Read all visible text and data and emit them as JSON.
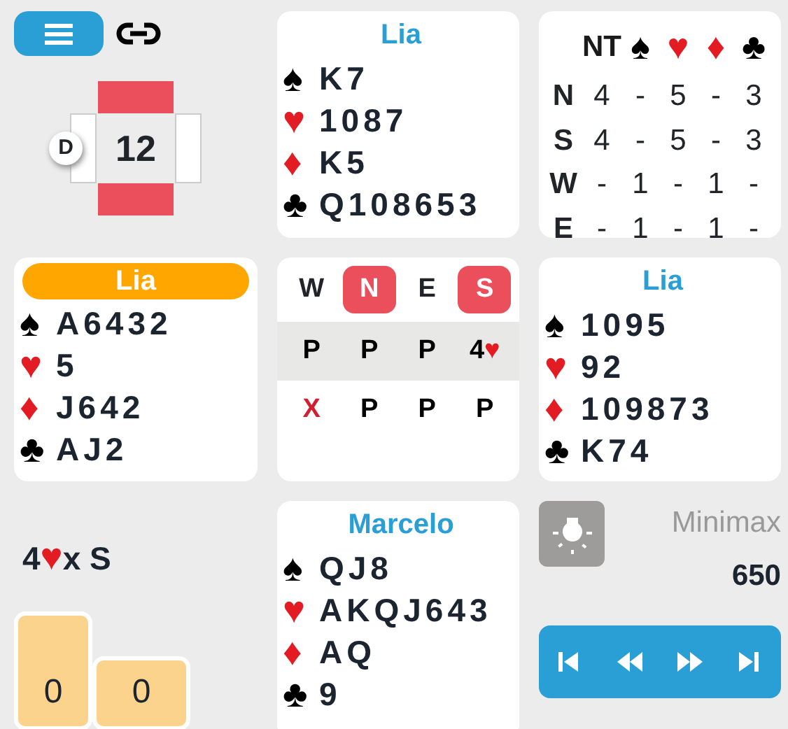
{
  "board": {
    "number": "12",
    "dealer_mark": "D",
    "west_is_dealer": true,
    "ns_vulnerable": true,
    "ew_vulnerable": false
  },
  "north": {
    "player": "Lia",
    "active": false,
    "suits": [
      {
        "symbol": "♠",
        "color": "#000000",
        "cards": "K7"
      },
      {
        "symbol": "♥",
        "color": "#e31b23",
        "cards": "1087"
      },
      {
        "symbol": "♦",
        "color": "#e31b23",
        "cards": "K5"
      },
      {
        "symbol": "♣",
        "color": "#000000",
        "cards": "Q108653"
      }
    ]
  },
  "par_table": {
    "columns": [
      {
        "label": "NT",
        "color": "#1a1a1a"
      },
      {
        "label": "♠",
        "color": "#000000"
      },
      {
        "label": "♥",
        "color": "#e31b23"
      },
      {
        "label": "♦",
        "color": "#e31b23"
      },
      {
        "label": "♣",
        "color": "#000000"
      }
    ],
    "rows": [
      {
        "seat": "N",
        "values": [
          "4",
          "-",
          "5",
          "-",
          "3"
        ]
      },
      {
        "seat": "S",
        "values": [
          "4",
          "-",
          "5",
          "-",
          "3"
        ]
      },
      {
        "seat": "W",
        "values": [
          "-",
          "1",
          "-",
          "1",
          "-"
        ]
      },
      {
        "seat": "E",
        "values": [
          "-",
          "1",
          "-",
          "1",
          "-"
        ]
      }
    ]
  },
  "west": {
    "player": "Lia",
    "active": true,
    "suits": [
      {
        "symbol": "♠",
        "color": "#000000",
        "cards": "A6432"
      },
      {
        "symbol": "♥",
        "color": "#e31b23",
        "cards": "5"
      },
      {
        "symbol": "♦",
        "color": "#e31b23",
        "cards": "J642"
      },
      {
        "symbol": "♣",
        "color": "#000000",
        "cards": "AJ2"
      }
    ]
  },
  "auction": {
    "seats": [
      {
        "label": "W",
        "vulnerable": false
      },
      {
        "label": "N",
        "vulnerable": true
      },
      {
        "label": "E",
        "vulnerable": false
      },
      {
        "label": "S",
        "vulnerable": true
      }
    ],
    "rows": [
      {
        "selected": true,
        "calls": [
          {
            "text": "P",
            "color": "#000000"
          },
          {
            "text": "P",
            "color": "#000000"
          },
          {
            "text": "P",
            "color": "#000000"
          },
          {
            "text": "4",
            "color": "#000000",
            "suit": {
              "text": "♥",
              "color": "#e31b23"
            }
          }
        ]
      },
      {
        "selected": false,
        "calls": [
          {
            "text": "X",
            "color": "#d0202e"
          },
          {
            "text": "P",
            "color": "#000000"
          },
          {
            "text": "P",
            "color": "#000000"
          },
          {
            "text": "P",
            "color": "#000000"
          }
        ]
      }
    ]
  },
  "east": {
    "player": "Lia",
    "active": false,
    "suits": [
      {
        "symbol": "♠",
        "color": "#000000",
        "cards": "1095"
      },
      {
        "symbol": "♥",
        "color": "#e31b23",
        "cards": "92"
      },
      {
        "symbol": "♦",
        "color": "#e31b23",
        "cards": "109873"
      },
      {
        "symbol": "♣",
        "color": "#000000",
        "cards": "K74"
      }
    ]
  },
  "contract": {
    "level": "4",
    "suit": {
      "text": "♥",
      "color": "#e31b23"
    },
    "rest": "x S"
  },
  "tricks": [
    {
      "value": "0"
    },
    {
      "value": "0"
    }
  ],
  "south": {
    "player": "Marcelo",
    "active": false,
    "suits": [
      {
        "symbol": "♠",
        "color": "#000000",
        "cards": "QJ8"
      },
      {
        "symbol": "♥",
        "color": "#e31b23",
        "cards": "AKQJ643"
      },
      {
        "symbol": "♦",
        "color": "#e31b23",
        "cards": "AQ"
      },
      {
        "symbol": "♣",
        "color": "#000000",
        "cards": "9"
      }
    ]
  },
  "analysis": {
    "engine": "Minimax",
    "score": "650"
  }
}
